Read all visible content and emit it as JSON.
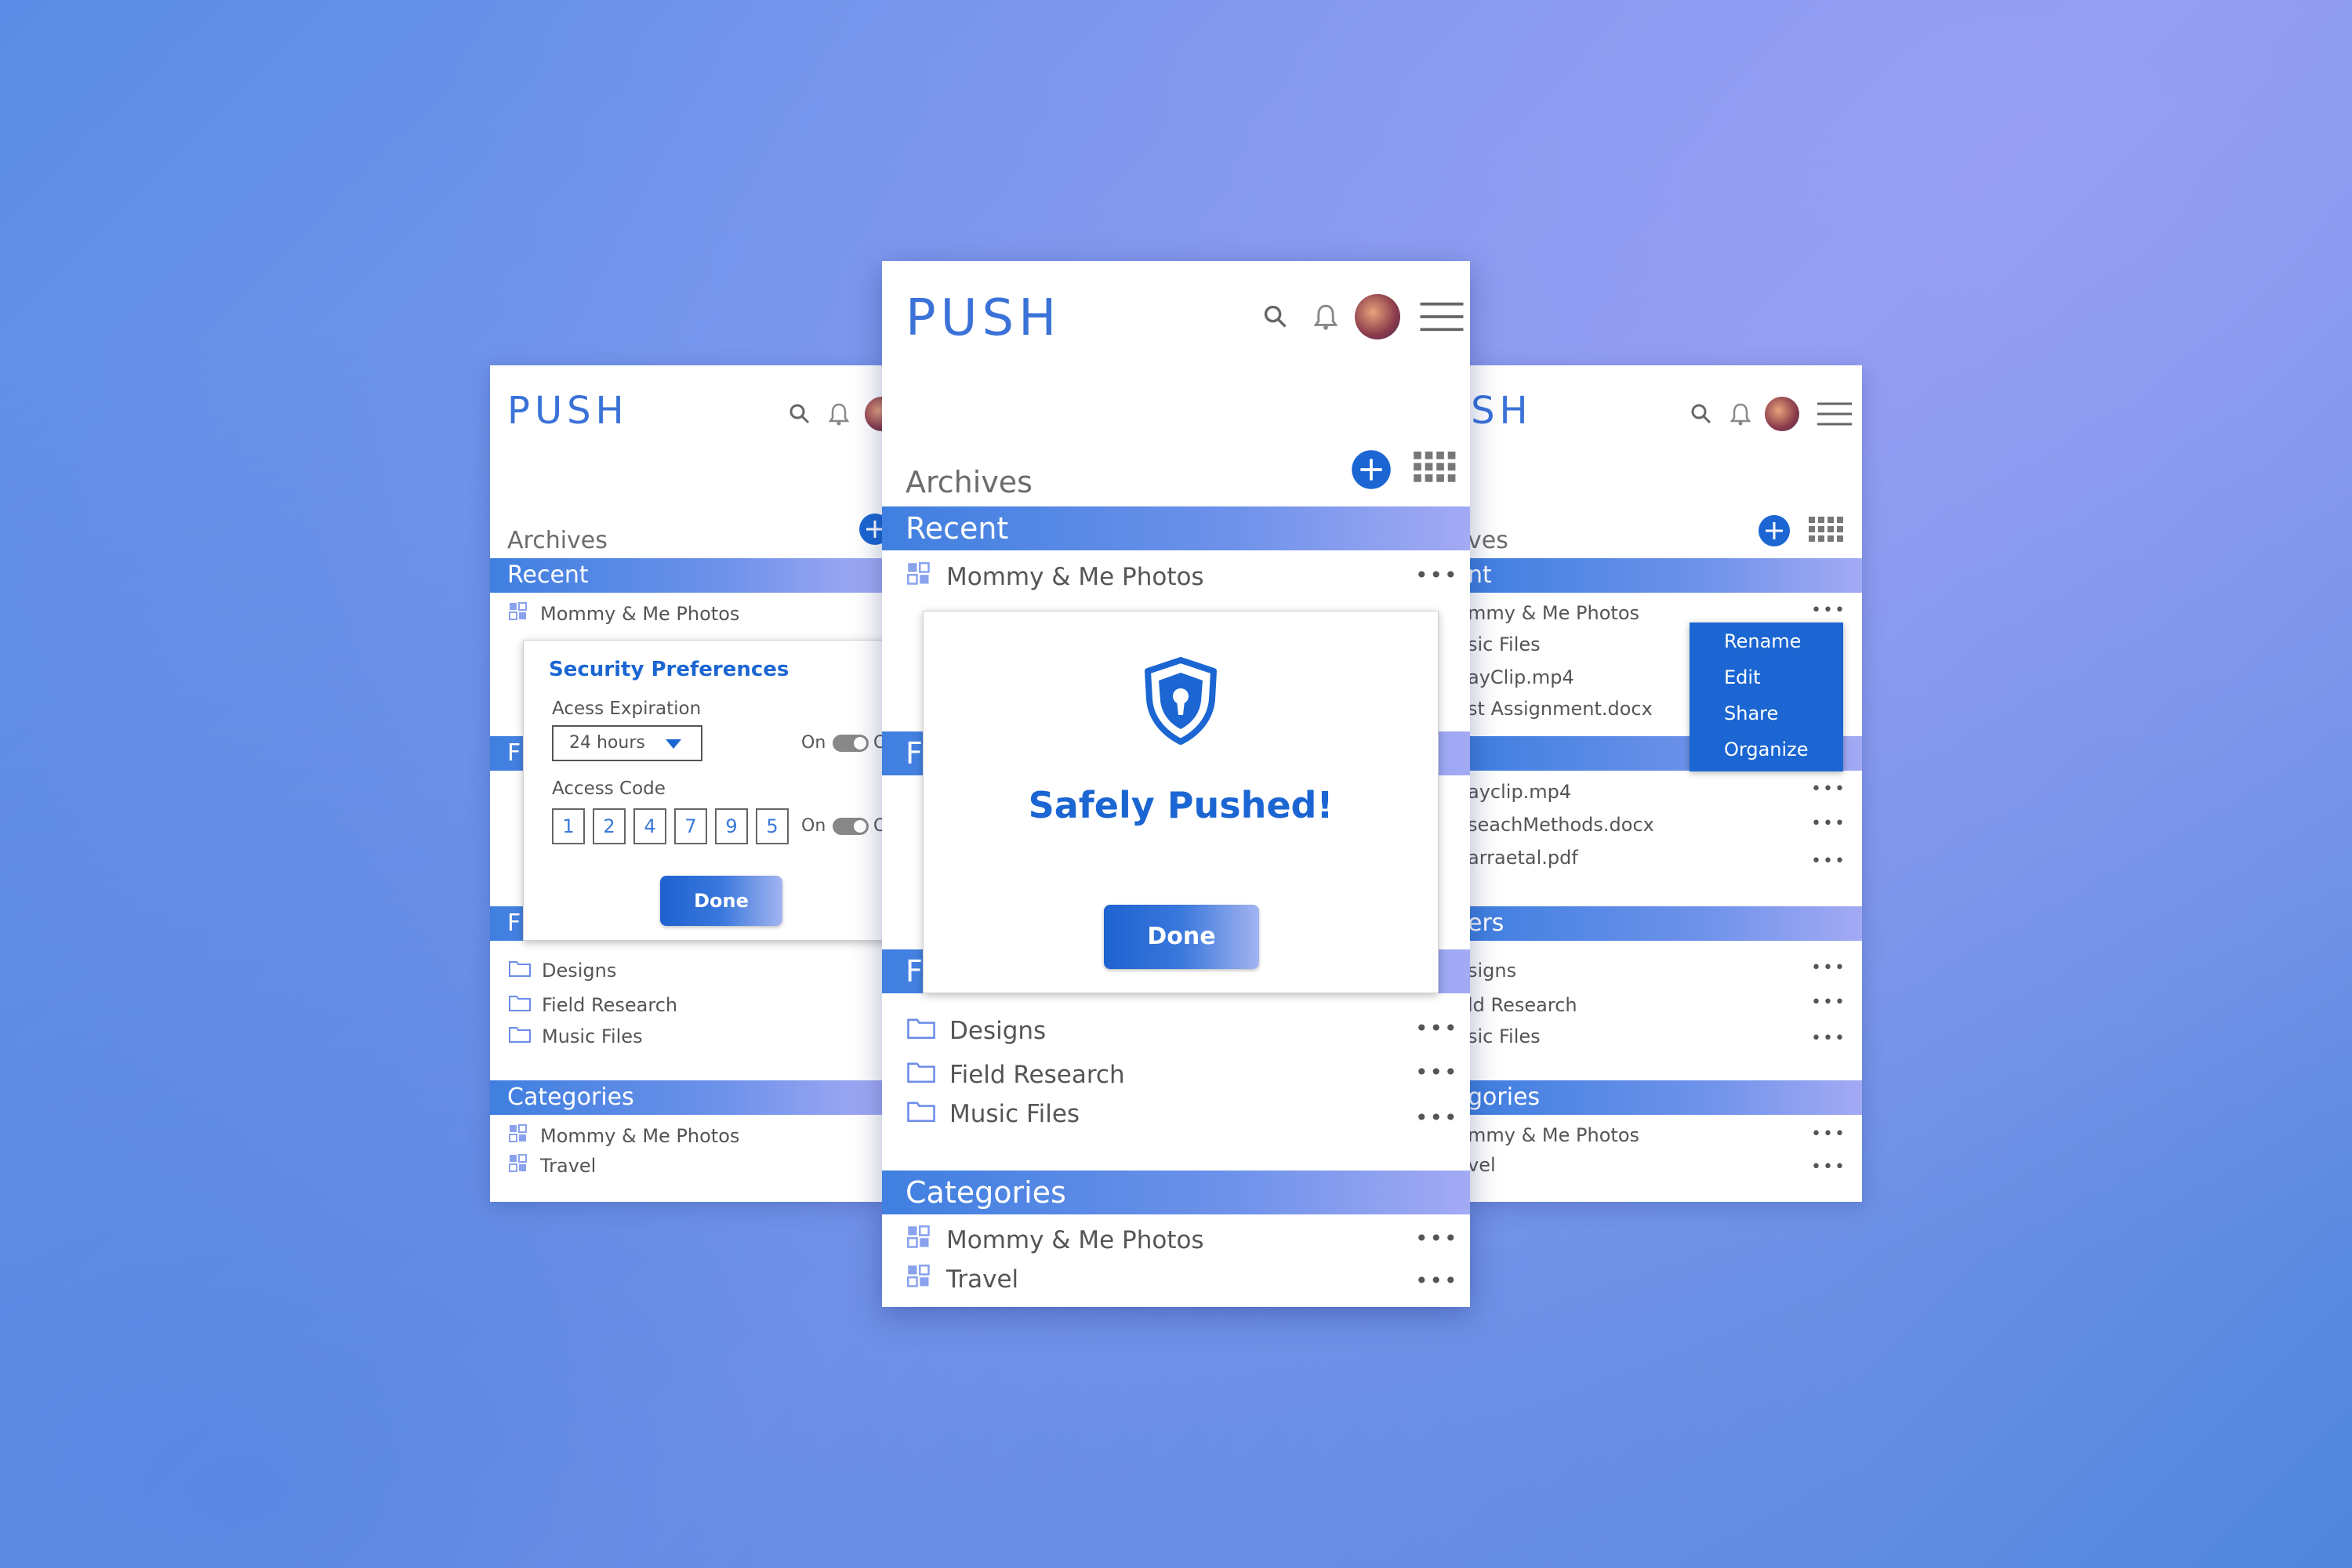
{
  "app": {
    "logo": "PUSH"
  },
  "left_screen": {
    "page_title": "Archives",
    "recent_label": "Recent",
    "recent_items": [
      "Mommy & Me Photos"
    ],
    "files_label": "F",
    "folders_label": "F",
    "folders": [
      "Designs",
      "Field Research",
      "Music Files"
    ],
    "categories_label": "Categories",
    "categories": [
      "Mommy & Me Photos",
      "Travel"
    ],
    "security_modal": {
      "title": "Security Preferences",
      "expiration_label": "Acess Expiration",
      "expiration_value": "24 hours",
      "expiration_toggle_label": "On",
      "expiration_toggle_cut": "O",
      "code_label": "Access Code",
      "code_digits": [
        "1",
        "2",
        "4",
        "7",
        "9",
        "5"
      ],
      "code_toggle_label": "On",
      "code_toggle_cut": "O",
      "done_label": "Done"
    }
  },
  "center_screen": {
    "page_title": "Archives",
    "recent_label": "Recent",
    "recent_items": [
      "Mommy & Me Photos"
    ],
    "files_label": "F",
    "folders_label": "F",
    "folders": [
      "Designs",
      "Field Research",
      "Music Files"
    ],
    "categories_label": "Categories",
    "categories": [
      "Mommy & Me Photos",
      "Travel"
    ],
    "more_glyph": "•••",
    "success_modal": {
      "message": "Safely Pushed!",
      "done_label": "Done"
    }
  },
  "right_screen": {
    "page_title_cut": "ves",
    "recent_label_cut": "nt",
    "recent_items_cut": [
      "mmy & Me Photos",
      "sic Files",
      "ayClip.mp4",
      "st Assignment.docx"
    ],
    "files_items_cut": [
      "ayclip.mp4",
      "seachMethods.docx",
      "arraetal.pdf"
    ],
    "folders_label_cut": "ers",
    "folders_cut": [
      "signs",
      "ld Research",
      "sic Files"
    ],
    "categories_label_cut": "gories",
    "categories_cut": [
      "mmy & Me Photos",
      "vel"
    ],
    "more_glyph": "•••",
    "context_menu": [
      "Rename",
      "Edit",
      "Share",
      "Organize"
    ]
  },
  "icons": {
    "search": "search-icon",
    "bell": "bell-icon",
    "menu": "hamburger-menu-icon",
    "add": "plus-circle-icon",
    "grid": "grid-view-icon",
    "folder": "folder-icon",
    "category": "category-tiles-icon",
    "shield": "shield-lock-icon"
  },
  "colors": {
    "brand_blue": "#1b66d2",
    "bar_gradient_start": "#3f7fe0",
    "bar_gradient_end": "#a3aaf4",
    "text_gray": "#555555"
  }
}
